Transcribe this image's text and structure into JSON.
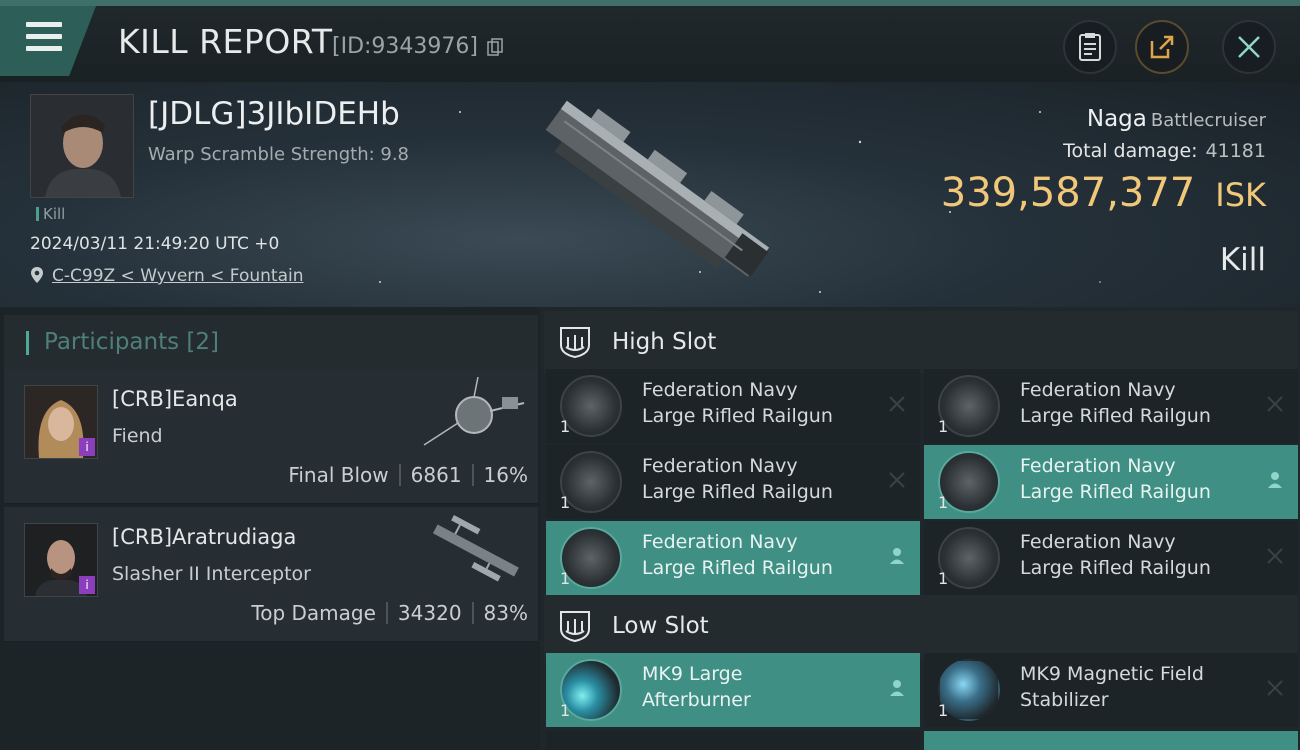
{
  "topbar": {
    "title": "KILL REPORT",
    "id_text": "[ID:9343976]",
    "buttons": [
      "clipboard",
      "share",
      "close"
    ]
  },
  "victim": {
    "name": "[JDLG]3JIbIDEHb",
    "warp_scramble": "Warp Scramble Strength: 9.8",
    "tag": "Kill",
    "datetime": "2024/03/11 21:49:20 UTC +0",
    "location": "C-C99Z < Wyvern < Fountain",
    "ship_name": "Naga",
    "ship_class": "Battlecruiser",
    "total_damage_label": "Total damage:",
    "total_damage": "41181",
    "isk_value": "339,587,377",
    "isk_unit": "ISK",
    "result": "Kill"
  },
  "participants": {
    "title": "Participants",
    "count": "[2]",
    "rows": [
      {
        "name": "[CRB]Eanqa",
        "ship": "Fiend",
        "role": "Final Blow",
        "damage": "6861",
        "percent": "16%"
      },
      {
        "name": "[CRB]Aratrudiaga",
        "ship": "Slasher II Interceptor",
        "role": "Top Damage",
        "damage": "34320",
        "percent": "83%"
      }
    ]
  },
  "slots": {
    "high": {
      "title": "High Slot",
      "items": [
        {
          "qty": "1",
          "line1": "Federation Navy",
          "line2": "Large Rifled Railgun",
          "status": "destroyed",
          "active": false
        },
        {
          "qty": "1",
          "line1": "Federation Navy",
          "line2": "Large Rifled Railgun",
          "status": "destroyed",
          "active": false
        },
        {
          "qty": "1",
          "line1": "Federation Navy",
          "line2": "Large Rifled Railgun",
          "status": "destroyed",
          "active": false
        },
        {
          "qty": "1",
          "line1": "Federation Navy",
          "line2": "Large Rifled Railgun",
          "status": "dropped",
          "active": true
        },
        {
          "qty": "1",
          "line1": "Federation Navy",
          "line2": "Large Rifled Railgun",
          "status": "dropped",
          "active": true
        },
        {
          "qty": "1",
          "line1": "Federation Navy",
          "line2": "Large Rifled Railgun",
          "status": "destroyed",
          "active": false
        }
      ]
    },
    "low": {
      "title": "Low Slot",
      "items": [
        {
          "qty": "1",
          "line1": "MK9 Large",
          "line2": "Afterburner",
          "status": "dropped",
          "active": true
        },
        {
          "qty": "1",
          "line1": "MK9 Magnetic Field",
          "line2": "Stabilizer",
          "status": "destroyed",
          "active": false
        }
      ]
    }
  },
  "colors": {
    "accent_teal": "#3f8f84",
    "isk_gold": "#f1c77a",
    "badge_purple": "#8c3fbd"
  }
}
